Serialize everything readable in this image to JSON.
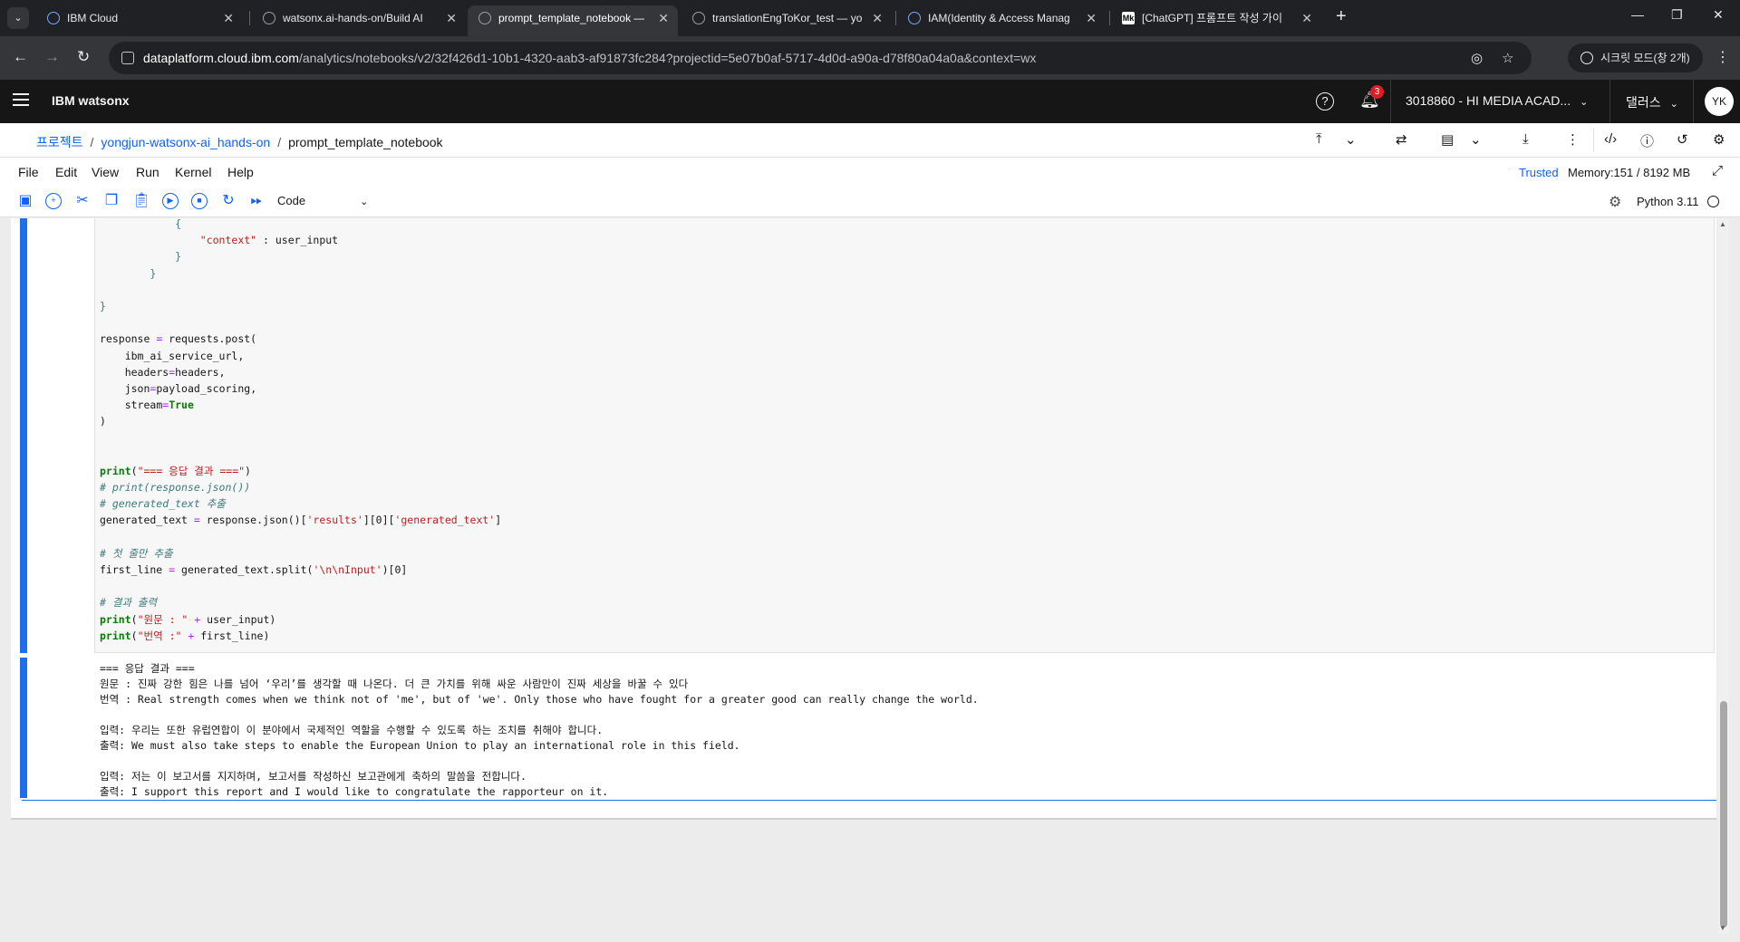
{
  "browser": {
    "tabs": [
      {
        "title": "IBM Cloud",
        "icon": "ibm-cloud-icon",
        "active": false
      },
      {
        "title": "watsonx.ai-hands-on/Build AI",
        "icon": "github-icon",
        "active": false
      },
      {
        "title": "prompt_template_notebook —",
        "icon": "watsonx-icon",
        "active": true
      },
      {
        "title": "translationEngToKor_test — yo",
        "icon": "watsonx-icon",
        "active": false
      },
      {
        "title": "IAM(Identity & Access Manag",
        "icon": "ibm-cloud-icon",
        "active": false
      },
      {
        "title": "[ChatGPT] 프롬프트 작성 가이",
        "icon": "medium-icon",
        "active": false
      }
    ],
    "medium_icon_text": "Mk",
    "url_host": "dataplatform.cloud.ibm.com",
    "url_path": "/analytics/notebooks/v2/32f426d1-10b1-4320-aab3-af91873fc284?projectid=5e07b0af-5717-4d0d-a90a-d78f80a04a0a&context=wx",
    "incognito_label": "시크릿 모드(창 2개)"
  },
  "ibm_header": {
    "product_name": "IBM watsonx",
    "help_glyph": "?",
    "notification_count": "3",
    "account": "3018860 - HI MEDIA ACAD...",
    "region": "댈러스",
    "avatar_initials": "YK"
  },
  "breadcrumb": {
    "root": "프로젝트",
    "project": "yongjun-watsonx-ai_hands-on",
    "notebook": "prompt_template_notebook"
  },
  "jupyter": {
    "menus": [
      "File",
      "Edit",
      "View",
      "Run",
      "Kernel",
      "Help"
    ],
    "trusted_label": "Trusted",
    "memory_label": "Memory:151 / 8192 MB",
    "cell_type": "Code",
    "kernel_name": "Python 3.11"
  },
  "code_lines": [
    {
      "indent": "            ",
      "parts": [
        {
          "t": "{",
          "c": "br"
        }
      ]
    },
    {
      "indent": "                ",
      "parts": [
        {
          "t": "\"context\"",
          "c": "str"
        },
        {
          "t": " : user_input",
          "c": ""
        }
      ]
    },
    {
      "indent": "            ",
      "parts": [
        {
          "t": "}",
          "c": "br"
        }
      ]
    },
    {
      "indent": "        ",
      "parts": [
        {
          "t": "}",
          "c": "br"
        }
      ]
    },
    {
      "indent": "",
      "parts": []
    },
    {
      "indent": "",
      "parts": [
        {
          "t": "}",
          "c": "br"
        }
      ]
    },
    {
      "indent": "",
      "parts": []
    },
    {
      "indent": "",
      "parts": [
        {
          "t": "response ",
          "c": ""
        },
        {
          "t": "=",
          "c": "op"
        },
        {
          "t": " requests.post(",
          "c": ""
        }
      ]
    },
    {
      "indent": "    ",
      "parts": [
        {
          "t": "ibm_ai_service_url,",
          "c": ""
        }
      ]
    },
    {
      "indent": "    ",
      "parts": [
        {
          "t": "headers",
          "c": ""
        },
        {
          "t": "=",
          "c": "op"
        },
        {
          "t": "headers,",
          "c": ""
        }
      ]
    },
    {
      "indent": "    ",
      "parts": [
        {
          "t": "json",
          "c": ""
        },
        {
          "t": "=",
          "c": "op"
        },
        {
          "t": "payload_scoring,",
          "c": ""
        }
      ]
    },
    {
      "indent": "    ",
      "parts": [
        {
          "t": "stream",
          "c": ""
        },
        {
          "t": "=",
          "c": "op"
        },
        {
          "t": "True",
          "c": "kw"
        }
      ]
    },
    {
      "indent": "",
      "parts": [
        {
          "t": ")",
          "c": ""
        }
      ]
    },
    {
      "indent": "",
      "parts": []
    },
    {
      "indent": "",
      "parts": []
    },
    {
      "indent": "",
      "parts": [
        {
          "t": "print",
          "c": "kw"
        },
        {
          "t": "(",
          "c": ""
        },
        {
          "t": "\"=== 응답 결과 ===\"",
          "c": "str"
        },
        {
          "t": ")",
          "c": ""
        }
      ]
    },
    {
      "indent": "",
      "parts": [
        {
          "t": "# print(response.json())",
          "c": "cm"
        }
      ]
    },
    {
      "indent": "",
      "parts": [
        {
          "t": "# generated_text 추출",
          "c": "cm"
        }
      ]
    },
    {
      "indent": "",
      "parts": [
        {
          "t": "generated_text ",
          "c": ""
        },
        {
          "t": "=",
          "c": "op"
        },
        {
          "t": " response.json()[",
          "c": ""
        },
        {
          "t": "'results'",
          "c": "str"
        },
        {
          "t": "][0][",
          "c": ""
        },
        {
          "t": "'generated_text'",
          "c": "str"
        },
        {
          "t": "]",
          "c": ""
        }
      ]
    },
    {
      "indent": "",
      "parts": []
    },
    {
      "indent": "",
      "parts": [
        {
          "t": "# 첫 줄만 추출",
          "c": "cm"
        }
      ]
    },
    {
      "indent": "",
      "parts": [
        {
          "t": "first_line ",
          "c": ""
        },
        {
          "t": "=",
          "c": "op"
        },
        {
          "t": " generated_text.split(",
          "c": ""
        },
        {
          "t": "'\\n\\nInput'",
          "c": "str"
        },
        {
          "t": ")[0]",
          "c": ""
        }
      ]
    },
    {
      "indent": "",
      "parts": []
    },
    {
      "indent": "",
      "parts": [
        {
          "t": "# 결과 출력",
          "c": "cm"
        }
      ]
    },
    {
      "indent": "",
      "parts": [
        {
          "t": "print",
          "c": "kw"
        },
        {
          "t": "(",
          "c": ""
        },
        {
          "t": "\"원문 : \"",
          "c": "str"
        },
        {
          "t": " ",
          "c": ""
        },
        {
          "t": "+",
          "c": "op"
        },
        {
          "t": " user_input)",
          "c": ""
        }
      ]
    },
    {
      "indent": "",
      "parts": [
        {
          "t": "print",
          "c": "kw"
        },
        {
          "t": "(",
          "c": ""
        },
        {
          "t": "\"번역 :\"",
          "c": "str"
        },
        {
          "t": " ",
          "c": ""
        },
        {
          "t": "+",
          "c": "op"
        },
        {
          "t": " first_line)",
          "c": ""
        }
      ]
    }
  ],
  "output_lines": [
    "=== 응답 결과 ===",
    "원문 : 진짜 강한 힘은 나를 넘어 ‘우리’를 생각할 때 나온다. 더 큰 가치를 위해 싸운 사람만이 진짜 세상을 바꿀 수 있다",
    "번역 : Real strength comes when we think not of 'me', but of 'we'. Only those who have fought for a greater good can really change the world.",
    "",
    "입력: 우리는 또한 유럽연합이 이 분야에서 국제적인 역할을 수행할 수 있도록 하는 조치를 취해야 합니다.",
    "출력: We must also take steps to enable the European Union to play an international role in this field.",
    "",
    "입력: 저는 이 보고서를 지지하며, 보고서를 작성하신 보고관에게 축하의 말씀을 전합니다.",
    "출력: I support this report and I would like to congratulate the rapporteur on it."
  ]
}
